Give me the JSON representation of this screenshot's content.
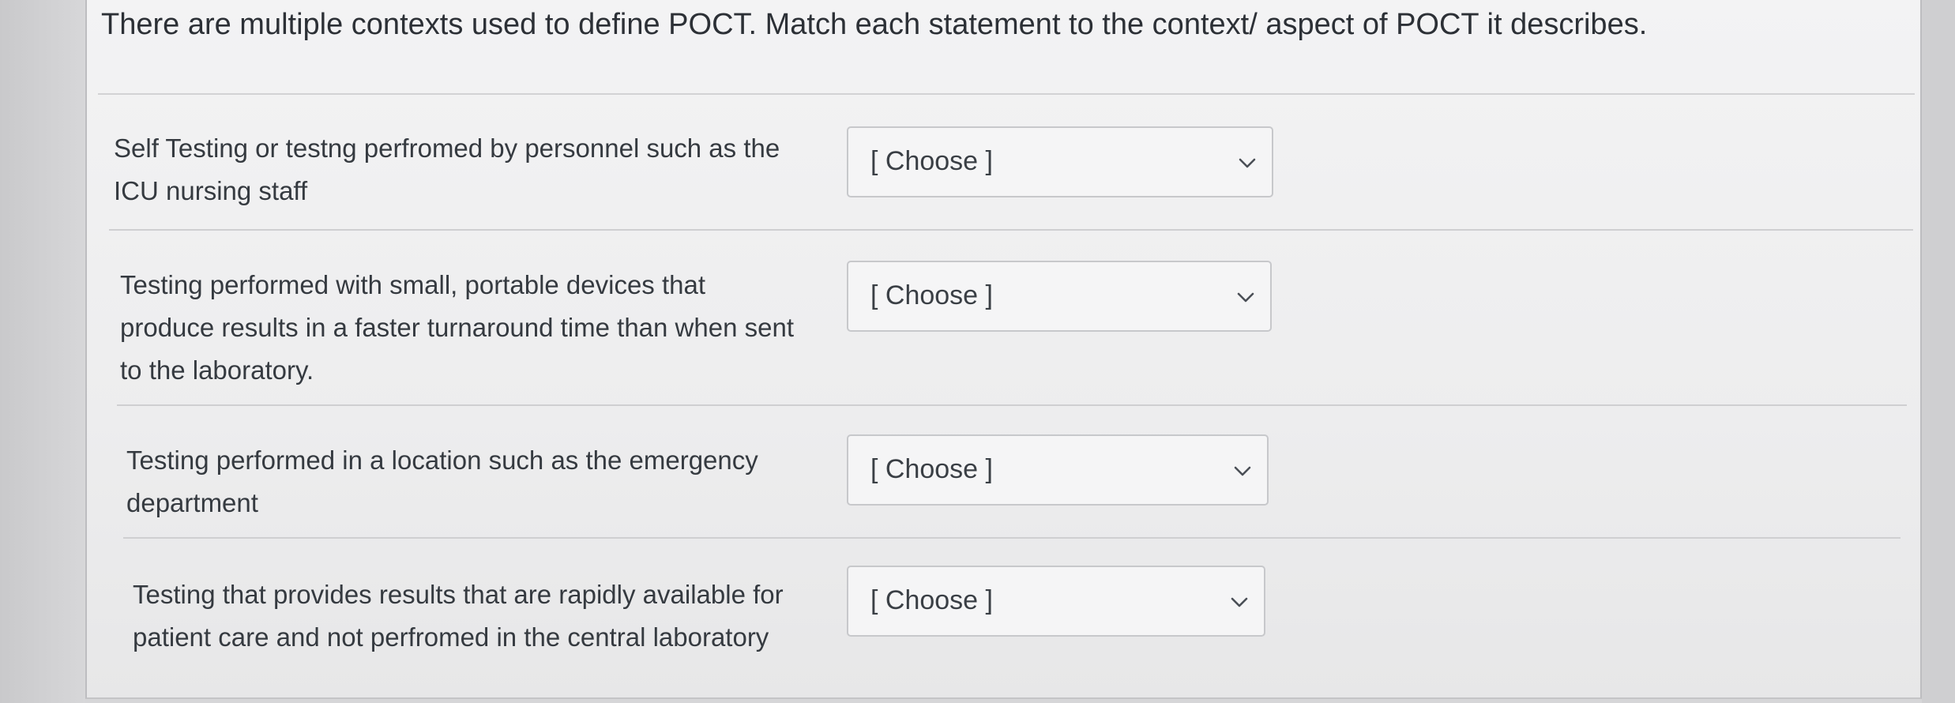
{
  "question": {
    "prompt": "There are multiple contexts used to define POCT. Match each statement to the context/ aspect of POCT it describes."
  },
  "matches": [
    {
      "statement_lines": [
        "Self Testing or testng perfromed by personnel such as the",
        "ICU nursing staff"
      ],
      "selected": "[ Choose ]",
      "icon": "chevron-down-icon"
    },
    {
      "statement_lines": [
        "Testing performed with small, portable devices that",
        "produce results in a faster turnaround time than when sent",
        "to the laboratory."
      ],
      "selected": "[ Choose ]",
      "icon": "chevron-down-icon"
    },
    {
      "statement_lines": [
        "Testing performed in a location such as the emergency",
        "department"
      ],
      "selected": "[ Choose ]",
      "icon": "chevron-down-icon"
    },
    {
      "statement_lines": [
        "Testing that provides results that are rapidly available for",
        "patient care and not perfromed in the central laboratory"
      ],
      "selected": "[ Choose ]",
      "icon": "chevron-down-icon"
    }
  ]
}
